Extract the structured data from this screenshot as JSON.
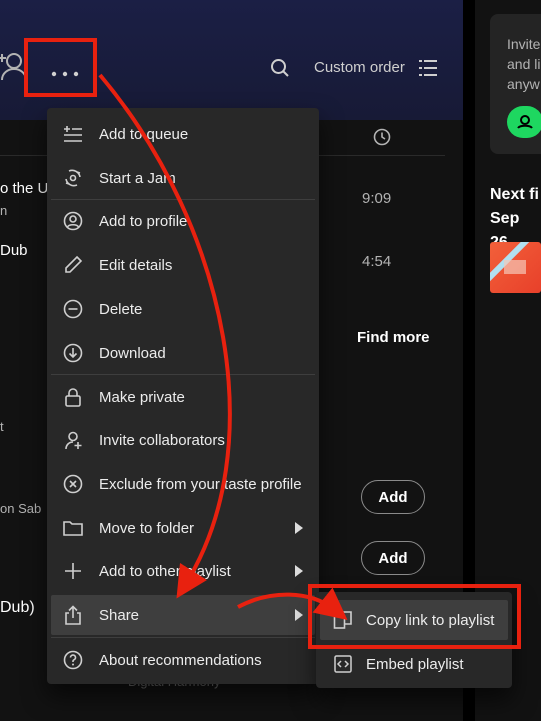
{
  "header": {
    "custom_order_label": "Custom order"
  },
  "tracks": {
    "row1_title": "o the U",
    "row1_sub": "n",
    "row1_duration": "9:09",
    "row2_title": "Dub",
    "row2_duration": "4:54",
    "row3_sub": "t",
    "row4_sub": "on Sab",
    "row5_title": "Dub)",
    "row6_sub": "Digital Harmony",
    "find_more": "Find more",
    "add_label_1": "Add",
    "add_label_2": "Add"
  },
  "right_panel": {
    "invite_text": [
      "Invite",
      "and li",
      "anyw"
    ],
    "next_label": "Next fi",
    "next_date": "Sep 26"
  },
  "menu": {
    "items": [
      {
        "label": "Add to queue",
        "icon": "add-to-queue-icon"
      },
      {
        "label": "Start a Jam",
        "icon": "jam-icon"
      },
      {
        "label": "Add to profile",
        "icon": "profile-icon"
      },
      {
        "label": "Edit details",
        "icon": "pencil-icon"
      },
      {
        "label": "Delete",
        "icon": "minus-circle-icon"
      },
      {
        "label": "Download",
        "icon": "download-icon"
      },
      {
        "label": "Make private",
        "icon": "lock-icon"
      },
      {
        "label": "Invite collaborators",
        "icon": "add-person-icon"
      },
      {
        "label": "Exclude from your taste profile",
        "icon": "exclude-icon"
      },
      {
        "label": "Move to folder",
        "icon": "folder-icon"
      },
      {
        "label": "Add to other playlist",
        "icon": "plus-icon"
      },
      {
        "label": "Share",
        "icon": "share-icon"
      },
      {
        "label": "About recommendations",
        "icon": "question-icon"
      }
    ]
  },
  "submenu": {
    "items": [
      {
        "label": "Copy link to playlist",
        "icon": "copy-icon"
      },
      {
        "label": "Embed playlist",
        "icon": "embed-icon"
      }
    ]
  },
  "colors": {
    "highlight": "#e8210f",
    "spotify_green": "#1ed760"
  }
}
